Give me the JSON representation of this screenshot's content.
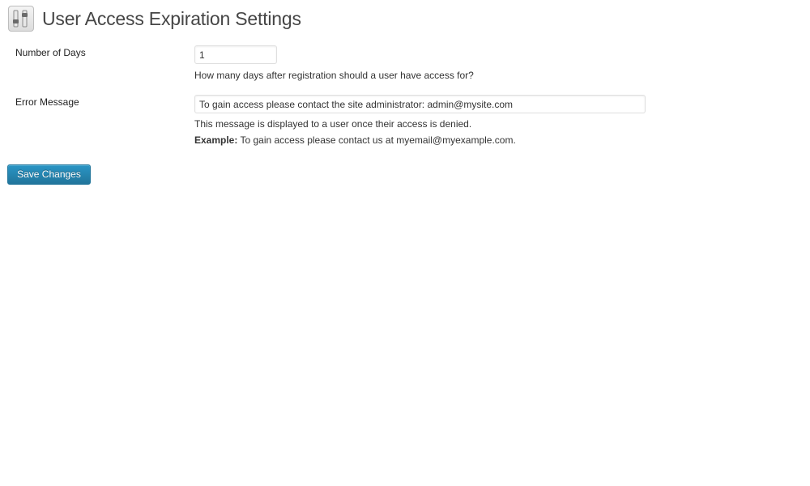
{
  "header": {
    "icon": "settings-sliders-icon",
    "title": "User Access Expiration Settings"
  },
  "fields": {
    "days": {
      "label": "Number of Days",
      "value": "1",
      "description": "How many days after registration should a user have access for?"
    },
    "error_message": {
      "label": "Error Message",
      "value": "To gain access please contact the site administrator: admin@mysite.com",
      "description": "This message is displayed to a user once their access is denied.",
      "example_label": "Example:",
      "example_text": " To gain access please contact us at myemail@myexample.com."
    }
  },
  "actions": {
    "save_label": "Save Changes"
  },
  "colors": {
    "button_primary": "#21759b",
    "title_text": "#464646"
  }
}
